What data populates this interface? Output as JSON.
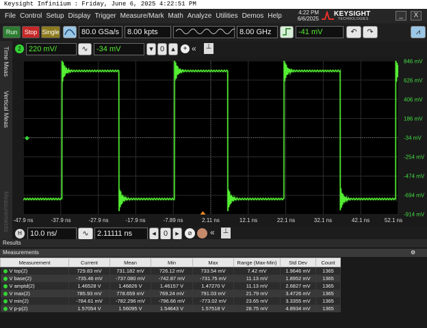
{
  "window_caption": "Keysight Infiniium : Friday, June 6, 2025 4:22:51 PM",
  "menu": [
    "File",
    "Control",
    "Setup",
    "Display",
    "Trigger",
    "Measure/Mark",
    "Math",
    "Analyze",
    "Utilities",
    "Demos",
    "Help"
  ],
  "clock": {
    "time": "4:22 PM",
    "date": "6/6/2025"
  },
  "brand": {
    "name": "KEYSIGHT",
    "subtitle": "TECHNOLOGIES"
  },
  "window_buttons": {
    "minimize": "_",
    "close": "X"
  },
  "toolbar": {
    "run": "Run",
    "stop": "Stop",
    "single": "Single",
    "sample_rate": "80.0 GSa/s",
    "memory_depth": "8.00 kpts",
    "bandwidth": "8.00 GHz",
    "trigger_level": "-41 mV"
  },
  "side_tabs": [
    "Time Meas",
    "Vertical Meas",
    "Measurements"
  ],
  "channel": {
    "number": "2",
    "scale": "220 mV/",
    "offset": "-34 mV"
  },
  "horizontal": {
    "label": "H",
    "scale": "10.0 ns/",
    "position": "2.11111 ns"
  },
  "x_ticks": [
    "-47.9 ns",
    "-37.9 ns",
    "-27.9 ns",
    "-17.9 ns",
    "-7.89 ns",
    "2.11 ns",
    "12.1 ns",
    "22.1 ns",
    "32.1 ns",
    "42.1 ns",
    "52.1 ns"
  ],
  "y_ticks": [
    "846 mV",
    "626 mV",
    "406 mV",
    "186 mV",
    "-34 mV",
    "-254 mV",
    "-474 mV",
    "-694 mV",
    "-914 mV"
  ],
  "colors": {
    "trace": "#55ee33",
    "grid": "#2e2e2e",
    "accent": "#35d335"
  },
  "chart_data": {
    "type": "line",
    "xlabel": "",
    "ylabel": "",
    "xlim": [
      -47.9,
      52.1
    ],
    "ylim": [
      -914,
      846
    ],
    "series": [
      {
        "name": "",
        "values": []
      }
    ],
    "x_unit": "ns",
    "y_unit": "mV",
    "high_level": 730,
    "low_level": -736,
    "rising_edges": [
      -37.6,
      -7.6,
      21.6,
      51.4
    ],
    "falling_edges": [
      -22.4,
      6.6,
      36.6
    ],
    "grid": true
  },
  "results": {
    "title": "Results",
    "panel": "Measurements",
    "columns": [
      "Measurement",
      "Current",
      "Mean",
      "Min",
      "Max",
      "Range (Max-Min)",
      "Std Dev",
      "Count"
    ],
    "rows": [
      [
        "V top(2)",
        "729.83 mV",
        "731.182 mV",
        "726.12 mV",
        "733.54 mV",
        "7.42 mV",
        "1.9646 mV",
        "1365"
      ],
      [
        "V base(2)",
        "-735.46 mV",
        "-737.080 mV",
        "-742.87 mV",
        "-731.75 mV",
        "11.13 mV",
        "1.8952 mV",
        "1365"
      ],
      [
        "V amptd(2)",
        "1.46528 V",
        "1.46826 V",
        "1.46157 V",
        "1.47270 V",
        "11.13 mV",
        "2.6827 mV",
        "1365"
      ],
      [
        "V max(2)",
        "785.93 mV",
        "778.659 mV",
        "769.24 mV",
        "791.03 mV",
        "21.79 mV",
        "3.4726 mV",
        "1365"
      ],
      [
        "V min(2)",
        "-784.61 mV",
        "-782.296 mV",
        "-796.66 mV",
        "-773.02 mV",
        "23.65 mV",
        "3.3355 mV",
        "1365"
      ],
      [
        "V p-p(2)",
        "1.57054 V",
        "1.56095 V",
        "1.54643 V",
        "1.57518 V",
        "28.75 mV",
        "4.8934 mV",
        "1365"
      ]
    ]
  }
}
